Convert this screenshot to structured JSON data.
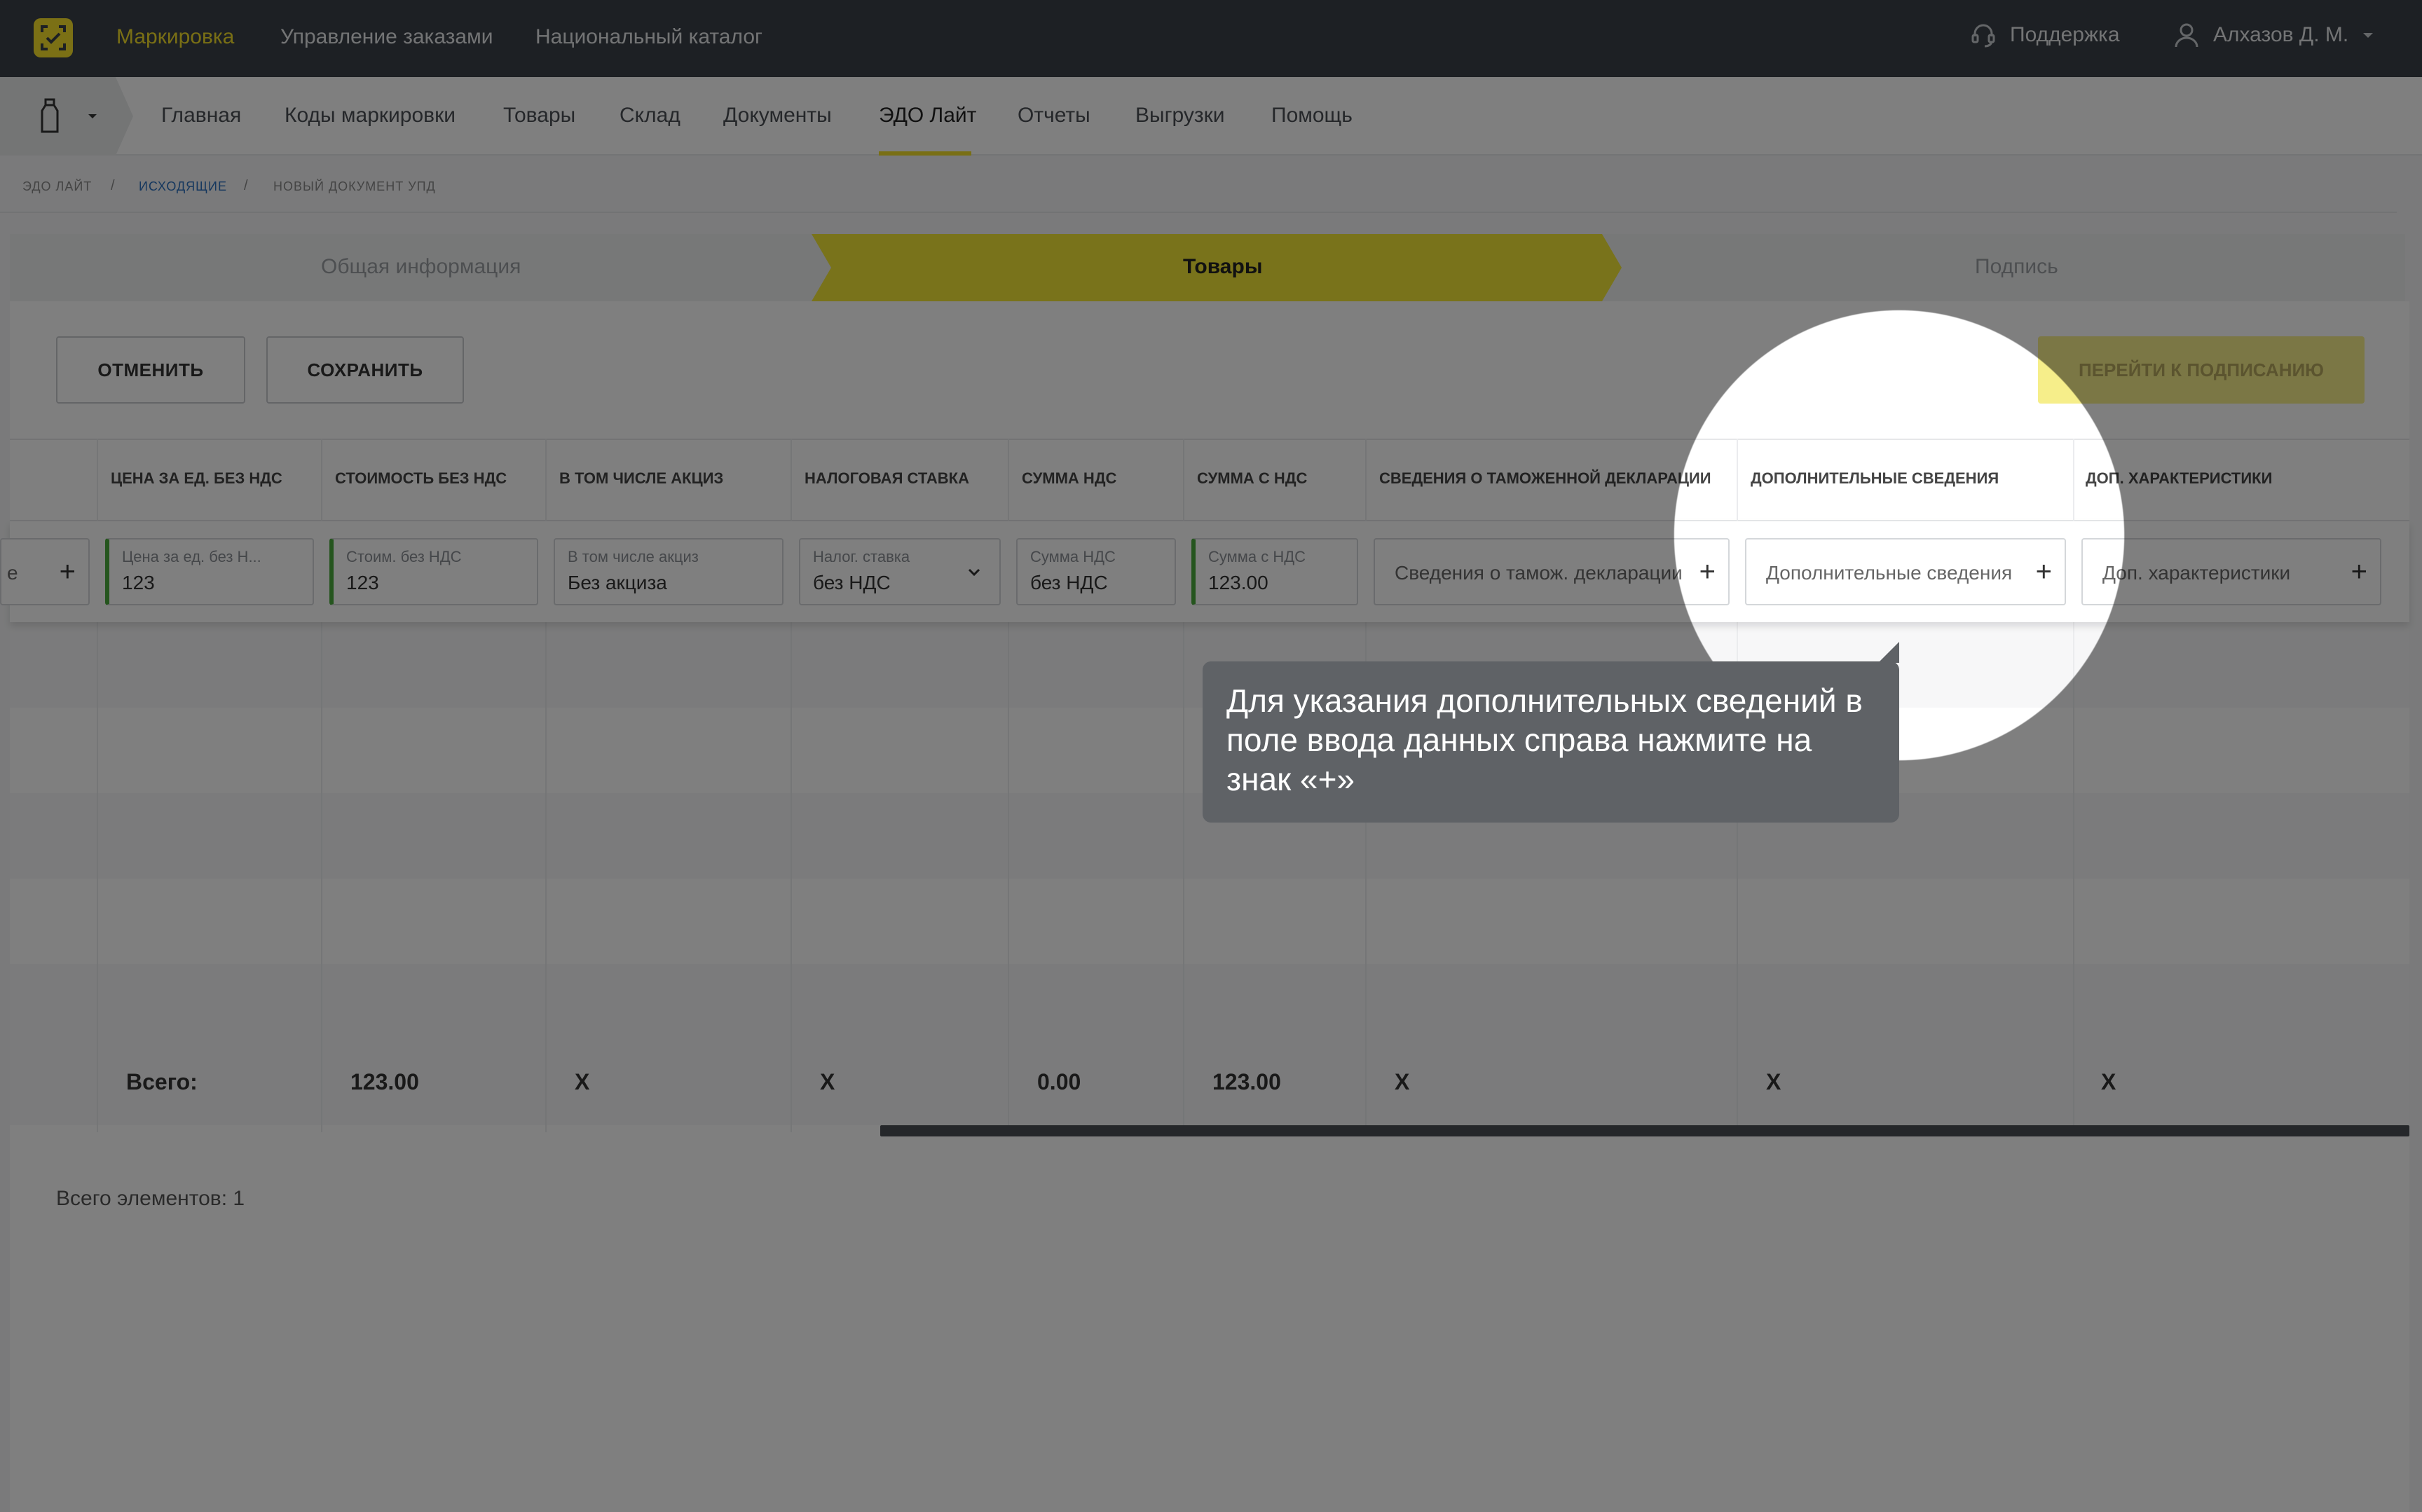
{
  "topbar": {
    "links": [
      "Маркировка",
      "Управление заказами",
      "Национальный каталог"
    ],
    "support": "Поддержка",
    "user": "Алхазов Д. М."
  },
  "nav": {
    "items": [
      "Главная",
      "Коды маркировки",
      "Товары",
      "Склад",
      "Документы",
      "ЭДО Лайт",
      "Отчеты",
      "Выгрузки",
      "Помощь"
    ],
    "active": "ЭДО Лайт"
  },
  "breadcrumb": [
    "ЭДО лайт",
    "исходящие",
    "новый документ упд"
  ],
  "steps": [
    "Общая информация",
    "Товары",
    "Подпись"
  ],
  "actions": {
    "cancel": "ОТМЕНИТЬ",
    "save": "СОХРАНИТЬ",
    "to_sign": "ПЕРЕЙТИ К ПОДПИСАНИЮ"
  },
  "table": {
    "headers": [
      "Цена за ед. без НДС",
      "Стоимость без НДС",
      "В том числе акциз",
      "Налоговая ставка",
      "Сумма НДС",
      "Сумма с НДС",
      "Сведения о таможенной декларации",
      "Дополнительные сведения",
      "Доп. характеристики"
    ],
    "row": {
      "partial_label": "е",
      "price": {
        "label": "Цена за ед. без Н...",
        "value": "123"
      },
      "cost": {
        "label": "Стоим. без НДС",
        "value": "123"
      },
      "excise": {
        "label": "В том числе акциз",
        "value": "Без акциза"
      },
      "tax_rate": {
        "label": "Налог. ставка",
        "value": "без НДС"
      },
      "vat_sum": {
        "label": "Сумма НДС",
        "value": "без НДС"
      },
      "sum_with_vat": {
        "label": "Сумма с НДС",
        "value": "123.00"
      },
      "customs": {
        "placeholder": "Сведения о тамож. декларации"
      },
      "additional": {
        "placeholder": "Дополнительные сведения"
      },
      "extra_chars": {
        "placeholder": "Доп. характеристики"
      }
    },
    "totals": {
      "label": "Всего:",
      "cost": "123.00",
      "excise": "X",
      "tax_rate": "X",
      "vat_sum": "0.00",
      "sum_with_vat": "123.00",
      "customs": "X",
      "additional": "X",
      "extra_chars": "X"
    },
    "count": "Всего элементов: 1"
  },
  "tooltip": {
    "text": "Для указания дополнительных сведений в поле ввода данных справа нажмите на знак «+»"
  },
  "colors": {
    "brand_yellow": "#f2de2a",
    "topbar": "#3b4148",
    "valid_green": "#4aab3c"
  }
}
